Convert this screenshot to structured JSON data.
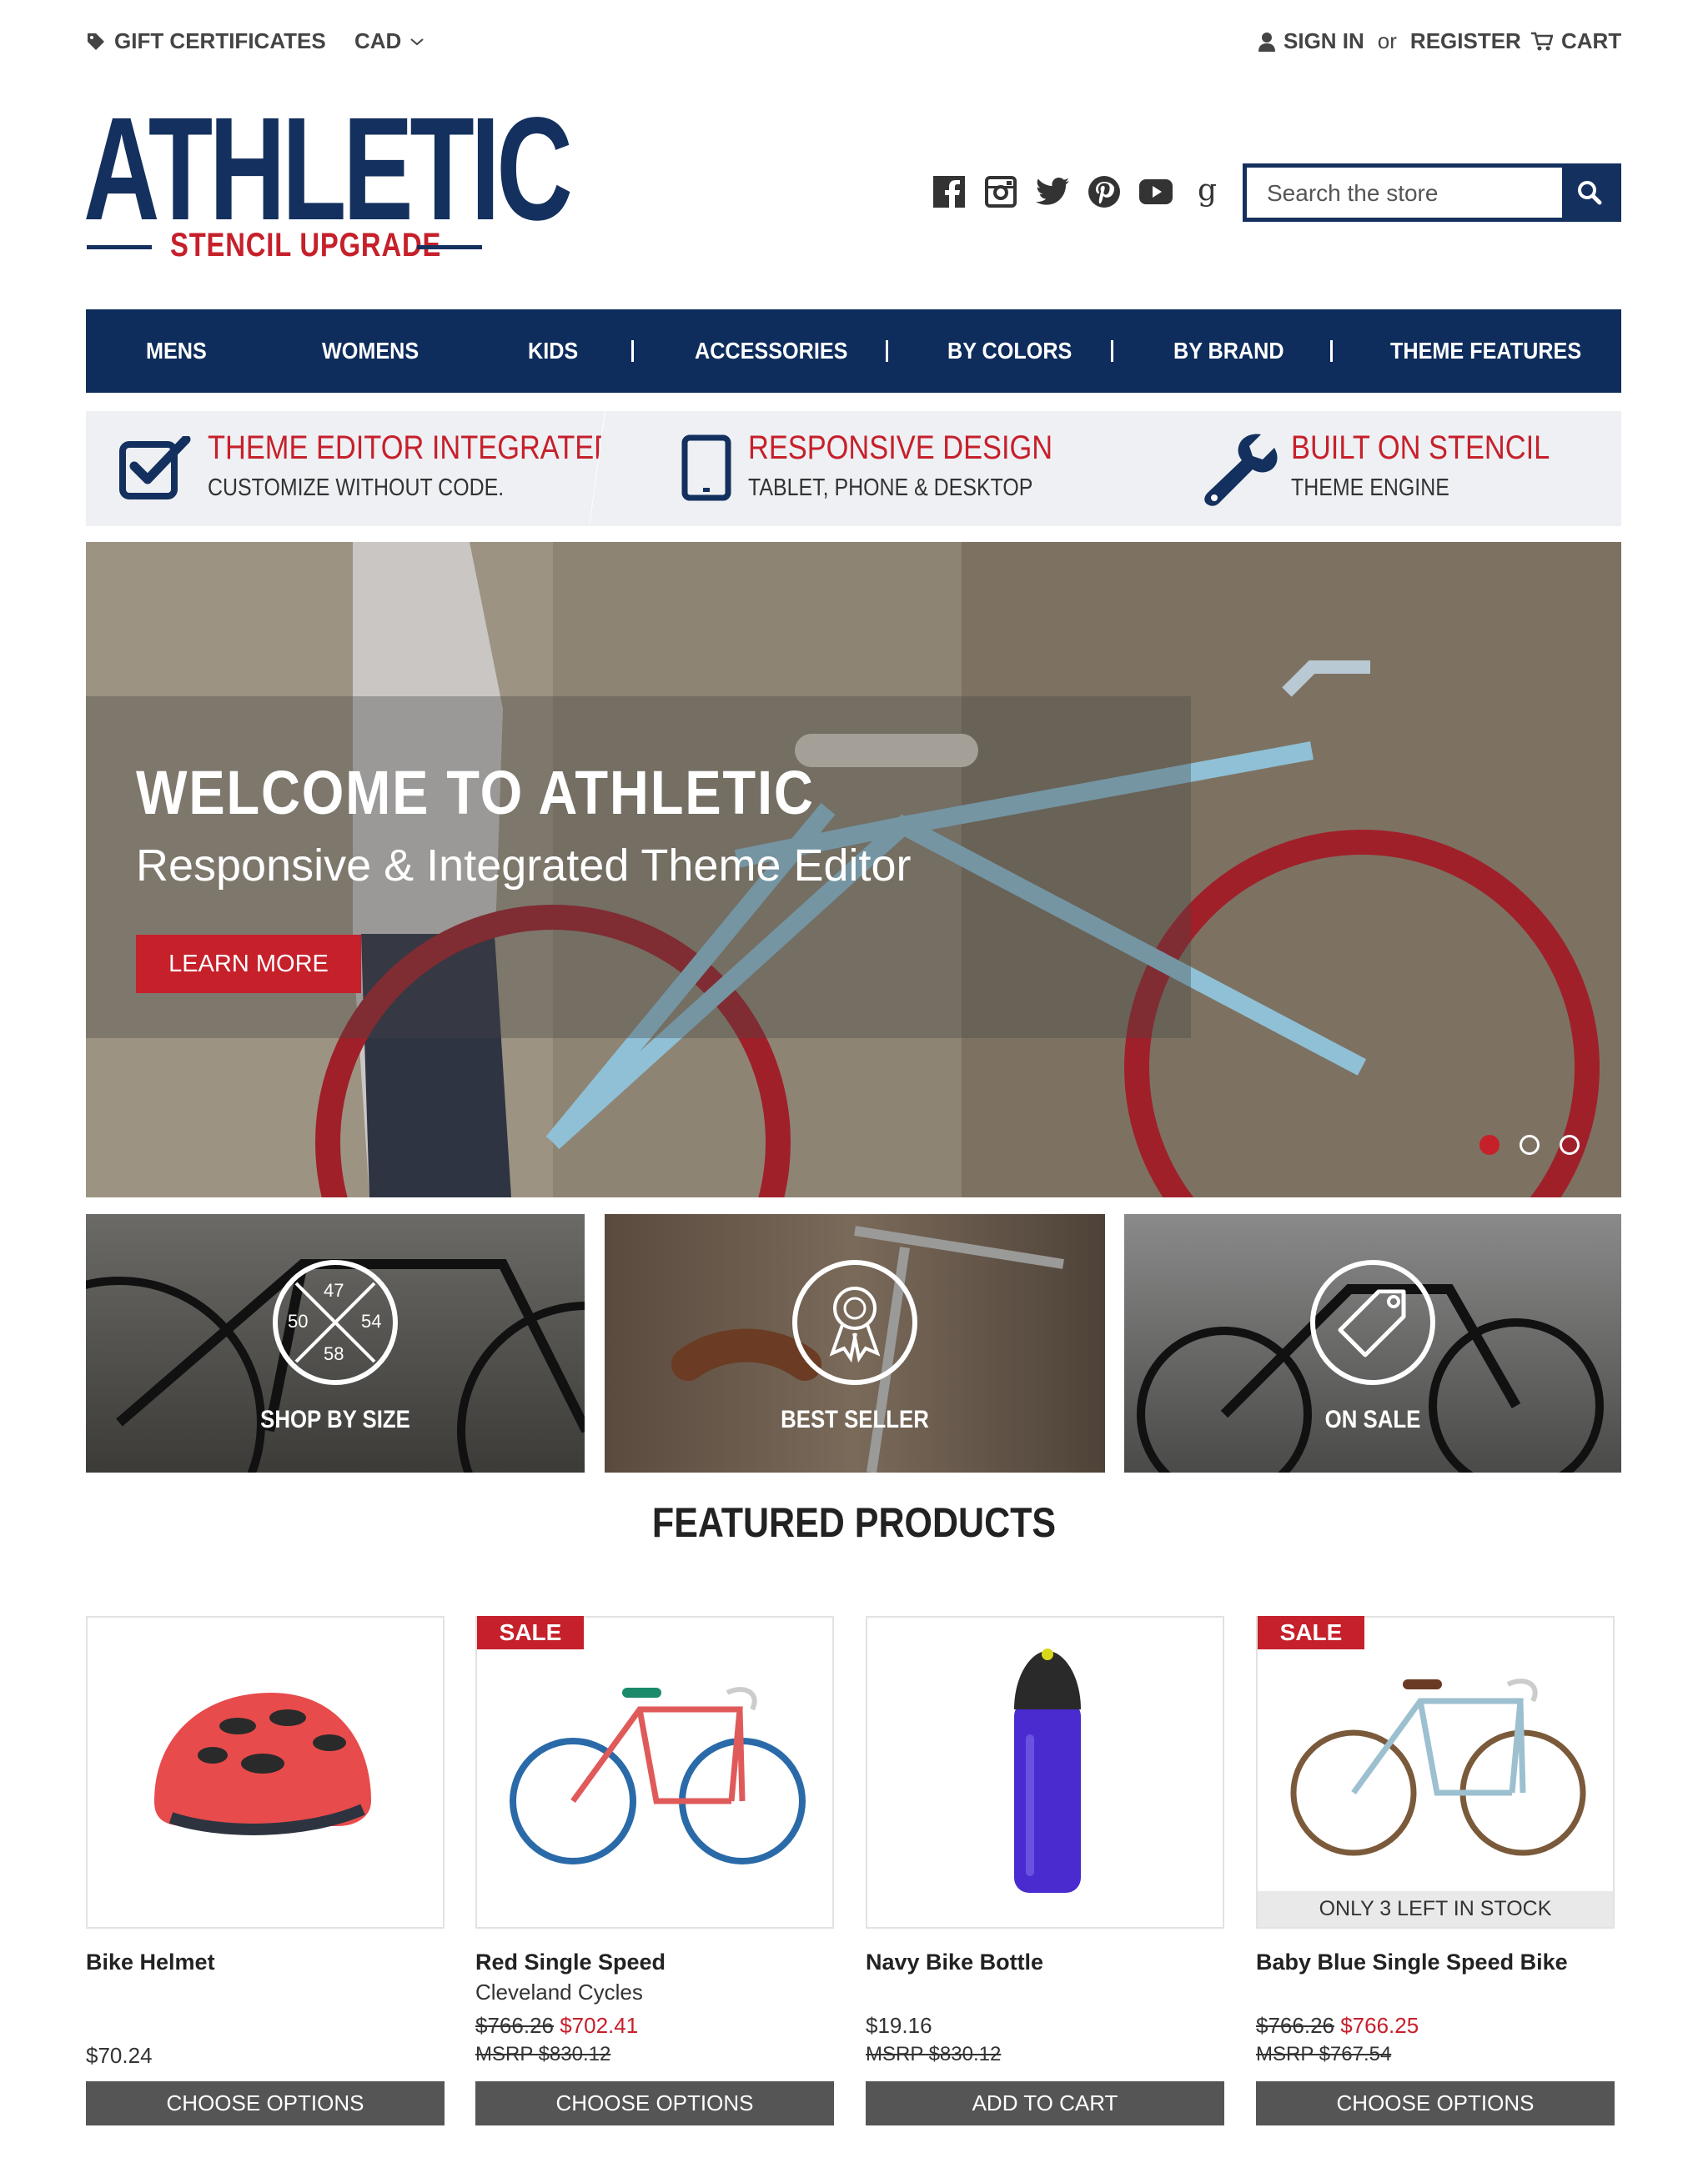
{
  "topbar": {
    "gift_certificates": "GIFT CERTIFICATES",
    "currency": "CAD",
    "sign_in": "SIGN IN",
    "or": "or",
    "register": "REGISTER",
    "cart": "CART"
  },
  "logo": {
    "main": "ATHLETIC",
    "sub": "STENCIL UPGRADE"
  },
  "social": [
    "facebook-icon",
    "instagram-icon",
    "twitter-icon",
    "pinterest-icon",
    "youtube-icon",
    "google-icon"
  ],
  "search": {
    "placeholder": "Search the store"
  },
  "nav": {
    "items": [
      "MENS",
      "WOMENS",
      "KIDS",
      "ACCESSORIES",
      "BY COLORS",
      "BY BRAND",
      "THEME FEATURES"
    ]
  },
  "features": [
    {
      "title": "THEME EDITOR INTEGRATED",
      "subtitle": "CUSTOMIZE WITHOUT CODE.",
      "icon": "checkbox-icon"
    },
    {
      "title": "RESPONSIVE DESIGN",
      "subtitle": "TABLET, PHONE & DESKTOP",
      "icon": "tablet-icon"
    },
    {
      "title": "BUILT ON STENCIL",
      "subtitle": "THEME ENGINE",
      "icon": "wrench-icon"
    }
  ],
  "hero": {
    "title": "WELCOME TO ATHLETIC",
    "subtitle": "Responsive & Integrated Theme Editor",
    "button": "LEARN MORE",
    "active_slide": 1,
    "slide_count": 3
  },
  "tiles": [
    {
      "label": "SHOP BY SIZE",
      "sizes": [
        "47",
        "50",
        "54",
        "58"
      ]
    },
    {
      "label": "BEST SELLER"
    },
    {
      "label": "ON SALE"
    }
  ],
  "featured": {
    "title": "FEATURED PRODUCTS",
    "products": [
      {
        "name": "Bike Helmet",
        "brand": "",
        "price": "$70.24",
        "was": "",
        "now": "",
        "msrp": "",
        "sale": "",
        "stock": "",
        "button": "CHOOSE OPTIONS"
      },
      {
        "name": "Red Single Speed",
        "brand": "Cleveland Cycles",
        "price": "",
        "was": "$766.26",
        "now": "$702.41",
        "msrp": "MSRP $830.12",
        "sale": "SALE",
        "stock": "",
        "button": "CHOOSE OPTIONS"
      },
      {
        "name": "Navy Bike Bottle",
        "brand": "",
        "price": "$19.16",
        "was": "",
        "now": "",
        "msrp": "MSRP $830.12",
        "sale": "",
        "stock": "",
        "button": "ADD TO CART"
      },
      {
        "name": "Baby Blue Single Speed Bike",
        "brand": "",
        "price": "",
        "was": "$766.26",
        "now": "$766.25",
        "msrp": "MSRP $767.54",
        "sale": "SALE",
        "stock": "ONLY 3 LEFT IN STOCK",
        "button": "CHOOSE OPTIONS"
      }
    ]
  },
  "colors": {
    "navy": "#14305e",
    "red": "#c6202b",
    "gray_button": "#555555"
  }
}
